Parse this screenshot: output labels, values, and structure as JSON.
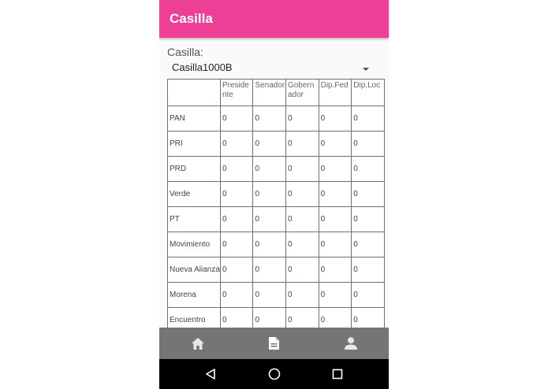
{
  "app": {
    "title": "Casilla"
  },
  "form": {
    "label": "Casilla:",
    "selected": "Casilla1000B"
  },
  "table": {
    "columns": [
      "Preside nte",
      "Senador",
      "Gobern ador",
      "Dip.Fed",
      "Dip.Loc"
    ],
    "rows": [
      {
        "party": "PAN",
        "values": [
          "0",
          "0",
          "0",
          "0",
          "0"
        ]
      },
      {
        "party": "PRI",
        "values": [
          "0",
          "0",
          "0",
          "0",
          "0"
        ]
      },
      {
        "party": "PRD",
        "values": [
          "0",
          "0",
          "0",
          "0",
          "0"
        ]
      },
      {
        "party": "Verde",
        "values": [
          "0",
          "0",
          "0",
          "0",
          "0"
        ]
      },
      {
        "party": "PT",
        "values": [
          "0",
          "0",
          "0",
          "0",
          "0"
        ]
      },
      {
        "party": "Movimiento",
        "values": [
          "0",
          "0",
          "0",
          "0",
          "0"
        ]
      },
      {
        "party": "Nueva Alianza",
        "values": [
          "0",
          "0",
          "0",
          "0",
          "0"
        ]
      },
      {
        "party": "Morena",
        "values": [
          "0",
          "0",
          "0",
          "0",
          "0"
        ]
      },
      {
        "party": "Encuentro",
        "values": [
          "0",
          "0",
          "0",
          "0",
          "0"
        ]
      }
    ]
  },
  "bottom_nav": {
    "items": [
      "home-icon",
      "document-icon",
      "person-icon"
    ]
  },
  "system_nav": {
    "items": [
      "back-icon",
      "home-circle-icon",
      "recents-icon"
    ]
  },
  "colors": {
    "accent": "#ee3f96",
    "bottom_nav": "#757575",
    "system_bar": "#000000"
  }
}
